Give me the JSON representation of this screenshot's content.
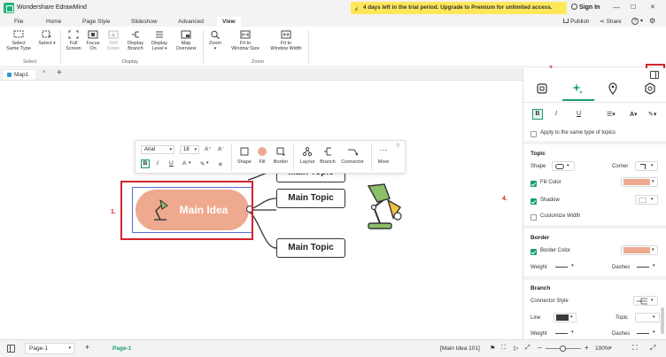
{
  "titlebar": {
    "app_title": "Wondershare EdrawMind",
    "trial_banner": "4 days left in the trial period. Upgrade to Premium for unlimited access.",
    "sign_in": "Sign In",
    "win_min": "—",
    "win_max": "☐",
    "win_close": "✕"
  },
  "menu": {
    "items": [
      "File",
      "Home",
      "Page Style",
      "Slideshow",
      "Advanced",
      "View"
    ],
    "active": "View",
    "publish": "Publish",
    "share": "Share",
    "help": "?"
  },
  "ribbon": {
    "buttons": [
      {
        "label1": "Select",
        "label2": "Same Type",
        "icon": "select-same-icon"
      },
      {
        "label1": "Select",
        "label2": "",
        "icon": "select-icon"
      },
      {
        "label1": "Full",
        "label2": "Screen",
        "icon": "fullscreen-icon"
      },
      {
        "label1": "Focus",
        "label2": "On",
        "icon": "focus-icon"
      },
      {
        "label1": "Drill",
        "label2": "Down",
        "icon": "drill-down-icon"
      },
      {
        "label1": "Display",
        "label2": "Branch",
        "icon": "display-branch-icon"
      },
      {
        "label1": "Display",
        "label2": "Level",
        "icon": "display-level-icon"
      },
      {
        "label1": "Map",
        "label2": "Overview",
        "icon": "map-overview-icon"
      },
      {
        "label1": "Zoom",
        "label2": "",
        "icon": "zoom-icon"
      },
      {
        "label1": "Fit to",
        "label2": "Window Size",
        "icon": "fit-window-icon"
      },
      {
        "label1": "Fit to",
        "label2": "Window Width",
        "icon": "fit-width-icon"
      }
    ],
    "groups": {
      "select": "Select",
      "display": "Display",
      "zoom": "Zoom"
    }
  },
  "tabs": {
    "doc": "Map1",
    "add": "+"
  },
  "float_toolbar": {
    "font": "Arial",
    "size": "18",
    "grow": "A⁺",
    "shrink": "A⁻",
    "bold": "B",
    "italic": "I",
    "underline": "U",
    "font_color": "A",
    "highlight": "✎",
    "clear": "⌀",
    "items": [
      "Shape",
      "Fill",
      "Border",
      "Layout",
      "Branch",
      "Connector",
      "More"
    ]
  },
  "mindmap": {
    "main_idea": "Main Idea",
    "topics": [
      "Main Topic",
      "Main Topic",
      "Main Topic"
    ],
    "fill_color": "#efa98f"
  },
  "annotations": [
    "1.",
    "2.",
    "3.",
    "4."
  ],
  "panel": {
    "format_bold": "B",
    "format_italic": "I",
    "format_underline": "U",
    "apply_same": "Apply to the same type of topics",
    "topic": {
      "title": "Topic",
      "shape_label": "Shape",
      "corner_label": "Corner",
      "fill_color_label": "Fill Color",
      "fill_color": "#efa98f",
      "shadow_label": "Shadow",
      "customize_width": "Customize Width"
    },
    "border": {
      "title": "Border",
      "border_color_label": "Border Color",
      "border_color": "#efa98f",
      "weight_label": "Weight",
      "dashes_label": "Dashes"
    },
    "branch": {
      "title": "Branch",
      "connector_style": "Connector Style",
      "line_label": "Line",
      "line_color": "#3a3a3a",
      "topic_label": "Topic",
      "weight_label": "Weight",
      "dashes_label": "Dashes"
    }
  },
  "statusbar": {
    "page_select": "Page-1",
    "add_page": "+",
    "active_page": "Page-1",
    "selection": "[Main Idea 101]",
    "zoom_minus": "−",
    "zoom_plus": "+",
    "zoom_value": "100%",
    "zoom_level": 0.5
  },
  "colors": {
    "accent": "#1a9e6a",
    "annotation": "#d3232b",
    "trial": "#ffe75a"
  }
}
